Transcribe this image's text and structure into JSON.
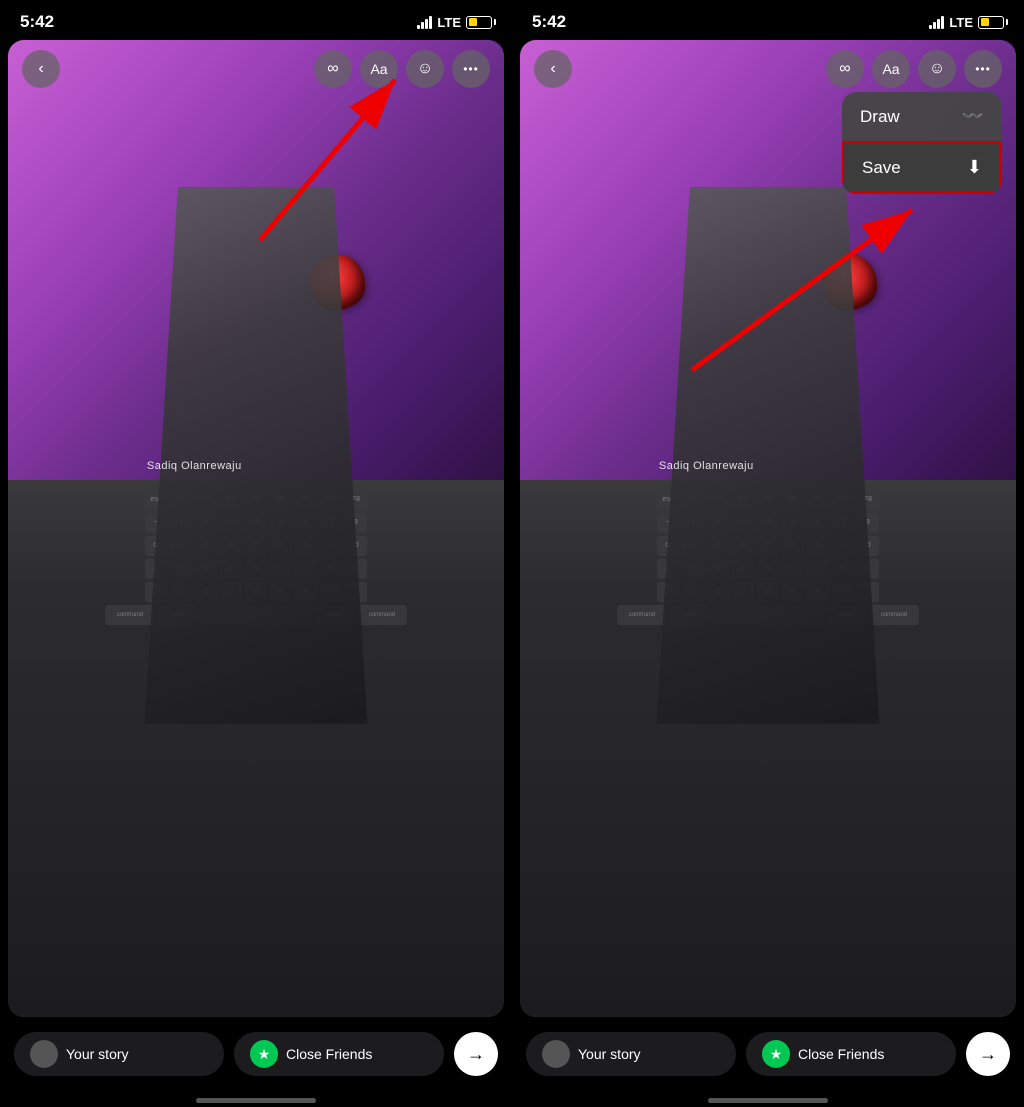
{
  "screens": [
    {
      "id": "left",
      "statusBar": {
        "time": "5:42",
        "signal": "LTE",
        "batteryColor": "#ffd60a"
      },
      "toolbar": {
        "backLabel": "‹",
        "infinityLabel": "∞",
        "textLabel": "Aa",
        "stickerLabel": "☺",
        "moreLabel": "•••"
      },
      "storyText": "Sadiq Olanrewaju",
      "bottomBar": {
        "yourStoryLabel": "Your story",
        "closeFriendsLabel": "Close Friends",
        "sendLabel": "→"
      }
    },
    {
      "id": "right",
      "statusBar": {
        "time": "5:42",
        "signal": "LTE",
        "batteryColor": "#ffd60a"
      },
      "toolbar": {
        "backLabel": "‹",
        "infinityLabel": "∞",
        "textLabel": "Aa",
        "stickerLabel": "☺",
        "moreLabel": "•••"
      },
      "dropdown": {
        "drawLabel": "Draw",
        "drawIcon": "〰",
        "saveLabel": "Save",
        "saveIcon": "⬇"
      },
      "storyText": "Sadiq Olanrewaju",
      "bottomBar": {
        "yourStoryLabel": "Your story",
        "closeFriendsLabel": "Close Friends",
        "sendLabel": "→"
      }
    }
  ]
}
